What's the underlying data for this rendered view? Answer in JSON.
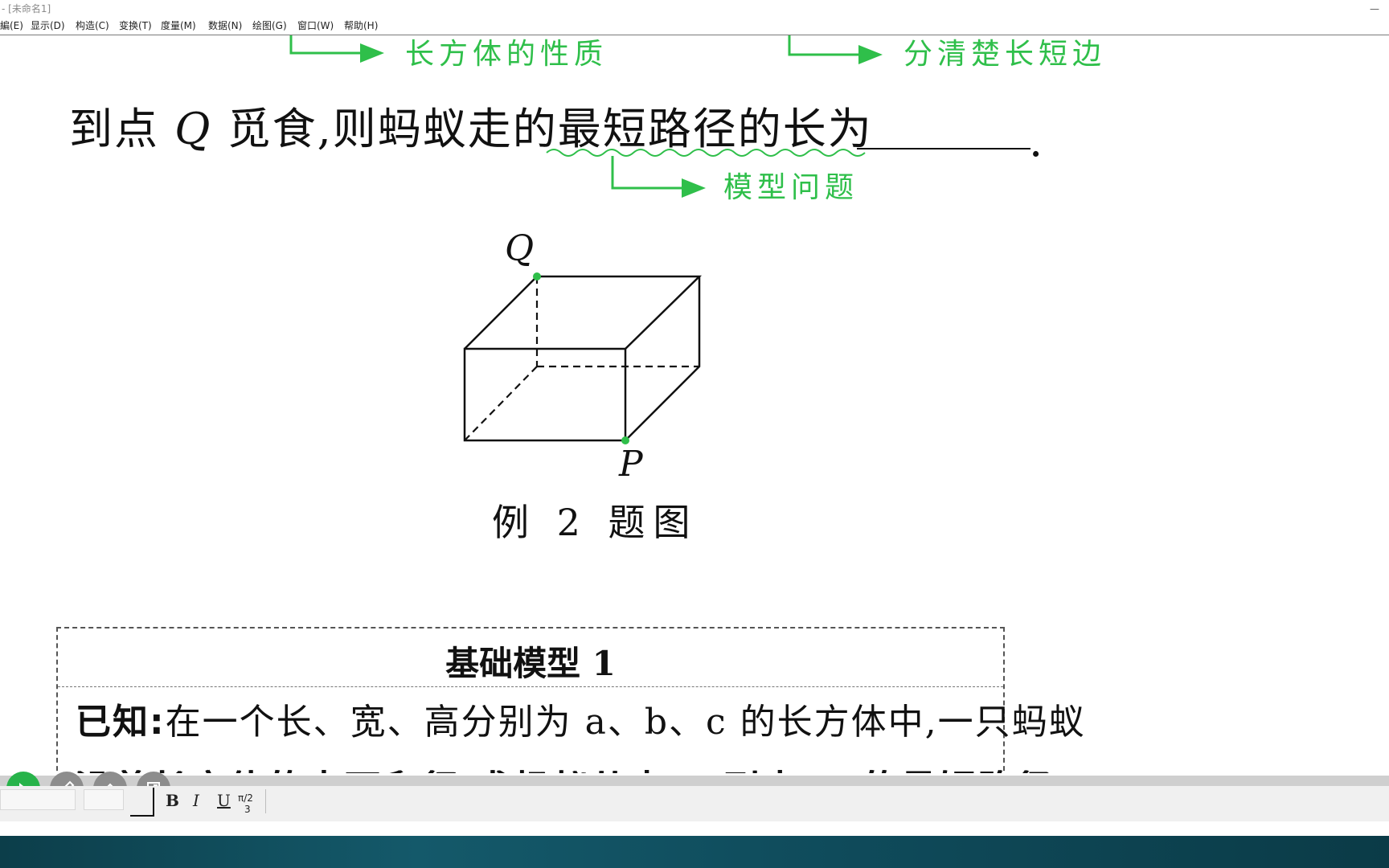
{
  "window": {
    "title": "- [未命名1]",
    "minimize": "—"
  },
  "menu": [
    "編(E)",
    "显示(D)",
    "构造(C)",
    "变换(T)",
    "度量(M)",
    "数据(N)",
    "绘图(G)",
    "窗口(W)",
    "帮助(H)"
  ],
  "notes": {
    "note1": "长方体的性质",
    "note2": "分清楚长短边",
    "note3": "模型问题"
  },
  "problem": {
    "prefix": "到点",
    "var_q": "Q",
    "middle": "觅食,则蚂蚁走的",
    "emphasis": "最短路径",
    "suffix": "的长为",
    "period": "."
  },
  "figure": {
    "label_q": "Q",
    "label_p": "P",
    "caption": "例 2 题图",
    "point_color": "#2fbf4a"
  },
  "model": {
    "title": "基础模型 1",
    "given_label": "已知:",
    "given_text": "在一个长、宽、高分别为 a、b、c 的长方体中,一只蚂蚁",
    "clipped_line1": "沿着长方体的表面爬行,求蚂蚁从点 P 到点 Q 的最短路径",
    "clipped_line2": "沿着长方体的表面爬行,求蚂蚁从点 P 到点 Q 的最短路径"
  },
  "toolbar": {
    "bold": "B",
    "italic": "I",
    "underline": "U",
    "math_symbol": "π/2",
    "math_sub": "3"
  },
  "colors": {
    "accent_green": "#2fbf4a",
    "tool_active": "#27b34a",
    "tool_idle": "#8d8d8d"
  }
}
